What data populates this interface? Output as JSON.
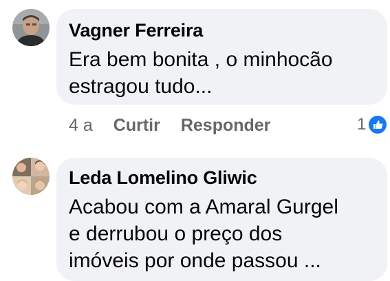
{
  "comments": [
    {
      "author": "Vagner Ferreira",
      "text": "Era bem bonita , o minhocão\nestragou tudo...",
      "time": "4 a",
      "like_label": "Curtir",
      "reply_label": "Responder",
      "reaction_count": "1",
      "reaction_icon": "like-icon"
    },
    {
      "author": "Leda Lomelino Gliwic",
      "text": "Acabou com a Amaral Gurgel\ne derrubou o preço dos\nimóveis por onde passou ..."
    }
  ],
  "colors": {
    "bubble": "#f0f2f5",
    "text": "#050505",
    "meta": "#65676b",
    "like_blue": "#1877f2"
  }
}
